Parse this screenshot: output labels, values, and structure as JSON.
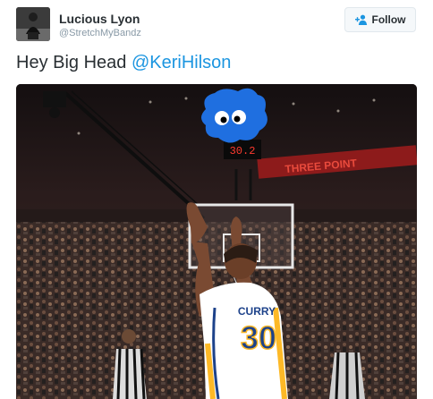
{
  "tweet": {
    "user": {
      "name": "Lucious Lyon",
      "handle": "@StretchMyBandz"
    },
    "follow_label": "Follow",
    "text": {
      "prefix": "Hey Big Head ",
      "mention": "@KeriHilson"
    },
    "photo": {
      "shot_clock": "30.2",
      "banner": "THREE POINT",
      "jersey_name": "CURRY",
      "jersey_number": "30"
    }
  },
  "colors": {
    "mention": "#1b95e0",
    "follow_icon": "#1b95e0",
    "jersey_white": "#ffffff",
    "jersey_blue": "#1d428a",
    "jersey_gold": "#fdb927",
    "cookie_monster": "#1f6fe0"
  },
  "icons": [
    "follow-person-icon"
  ]
}
